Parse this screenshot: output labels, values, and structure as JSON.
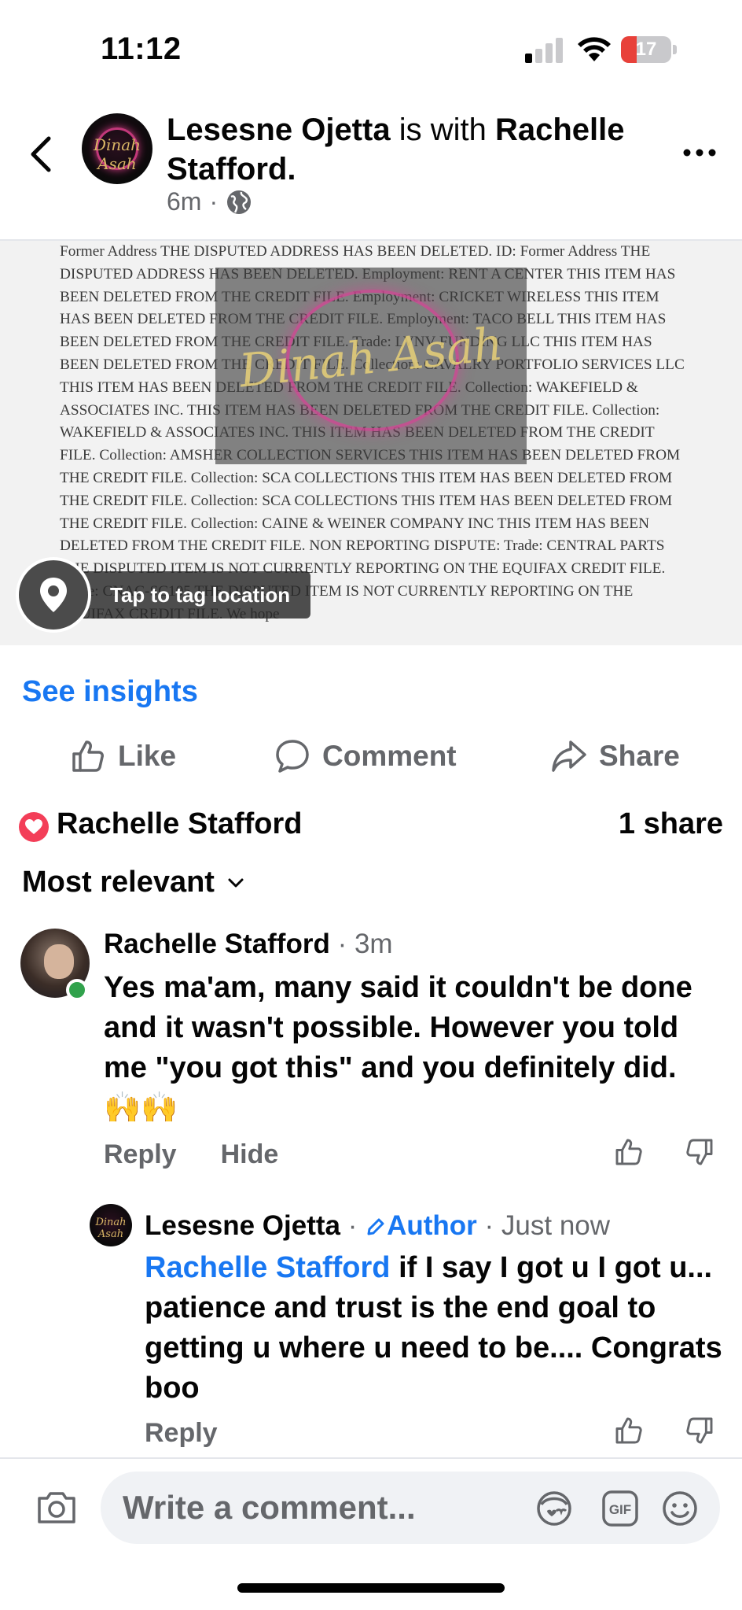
{
  "status_bar": {
    "time": "11:12",
    "battery_level": "17",
    "battery_fraction": 0.17,
    "battery_color": "#e8413a",
    "signal_bars_active": 1,
    "signal_bars_total": 4
  },
  "post": {
    "author": "Lesesne Ojetta",
    "with_text": " is with ",
    "tagged": "Rachelle Stafford",
    "tagged_suffix": ".",
    "time": "6m",
    "separator": "·",
    "audience_icon": "globe-icon",
    "avatar_text": "Dinah Asah"
  },
  "image": {
    "document_text": "Former Address THE DISPUTED ADDRESS HAS BEEN DELETED. ID: Former Address THE DISPUTED ADDRESS HAS BEEN DELETED. Employment: RENT A CENTER THIS ITEM HAS BEEN DELETED FROM THE CREDIT FILE. Employment: CRICKET WIRELESS THIS ITEM HAS BEEN DELETED FROM THE CREDIT FILE. Employment: TACO BELL THIS ITEM HAS BEEN DELETED FROM THE CREDIT FILE. Trade: LVNV FUNDING LLC THIS ITEM HAS BEEN DELETED FROM THE CREDIT FILE. Collection: CAVALRY PORTFOLIO SERVICES LLC THIS ITEM HAS BEEN DELETED FROM THE CREDIT FILE. Collection: WAKEFIELD & ASSOCIATES INC. THIS ITEM HAS BEEN DELETED FROM THE CREDIT FILE. Collection: WAKEFIELD & ASSOCIATES INC. THIS ITEM HAS BEEN DELETED FROM THE CREDIT FILE. Collection: AMSHER COLLECTION SERVICES THIS ITEM HAS BEEN DELETED FROM THE CREDIT FILE. Collection: SCA COLLECTIONS THIS ITEM HAS BEEN DELETED FROM THE CREDIT FILE. Collection: SCA COLLECTIONS THIS ITEM HAS BEEN DELETED FROM THE CREDIT FILE. Collection: CAINE & WEINER COMPANY INC THIS ITEM HAS BEEN DELETED FROM THE CREDIT FILE. NON REPORTING DISPUTE: Trade: CENTRAL PARTS THE DISPUTED ITEM IS NOT CURRENTLY REPORTING ON THE EQUIFAX CREDIT FILE. Trade: CNAC-SC105 THE DISPUTED ITEM IS NOT CURRENTLY REPORTING ON THE EQUIFAX CREDIT FILE. We hope",
    "watermark_text": "Dinah Asah",
    "tag_location_label": "Tap to tag location"
  },
  "insights": {
    "label": "See insights"
  },
  "actions": {
    "like": "Like",
    "comment": "Comment",
    "share": "Share"
  },
  "reactions": {
    "name": "Rachelle Stafford",
    "shares": "1 share"
  },
  "sort": {
    "label": "Most relevant"
  },
  "comments": [
    {
      "author": "Rachelle Stafford",
      "separator": " · ",
      "time": "3m",
      "text": "Yes ma'am, many said it couldn't be done and it wasn't possible. However you told me \"you got this\" and you definitely did. 🙌🙌",
      "reply": "Reply",
      "hide": "Hide"
    },
    {
      "author": "Lesesne Ojetta",
      "separator": " · ",
      "badge": "Author",
      "time": "Just now",
      "mention": "Rachelle Stafford",
      "text": " if I say I got u I got u... patience and trust is the end goal to getting u where u need to be.... Congrats boo",
      "reply": "Reply",
      "avatar_text": "Dinah Asah"
    }
  ],
  "composer": {
    "placeholder": "Write a comment..."
  },
  "colors": {
    "accent": "#1877f2",
    "secondary_text": "#65676b",
    "love": "#f33e58",
    "online": "#31a24c"
  }
}
